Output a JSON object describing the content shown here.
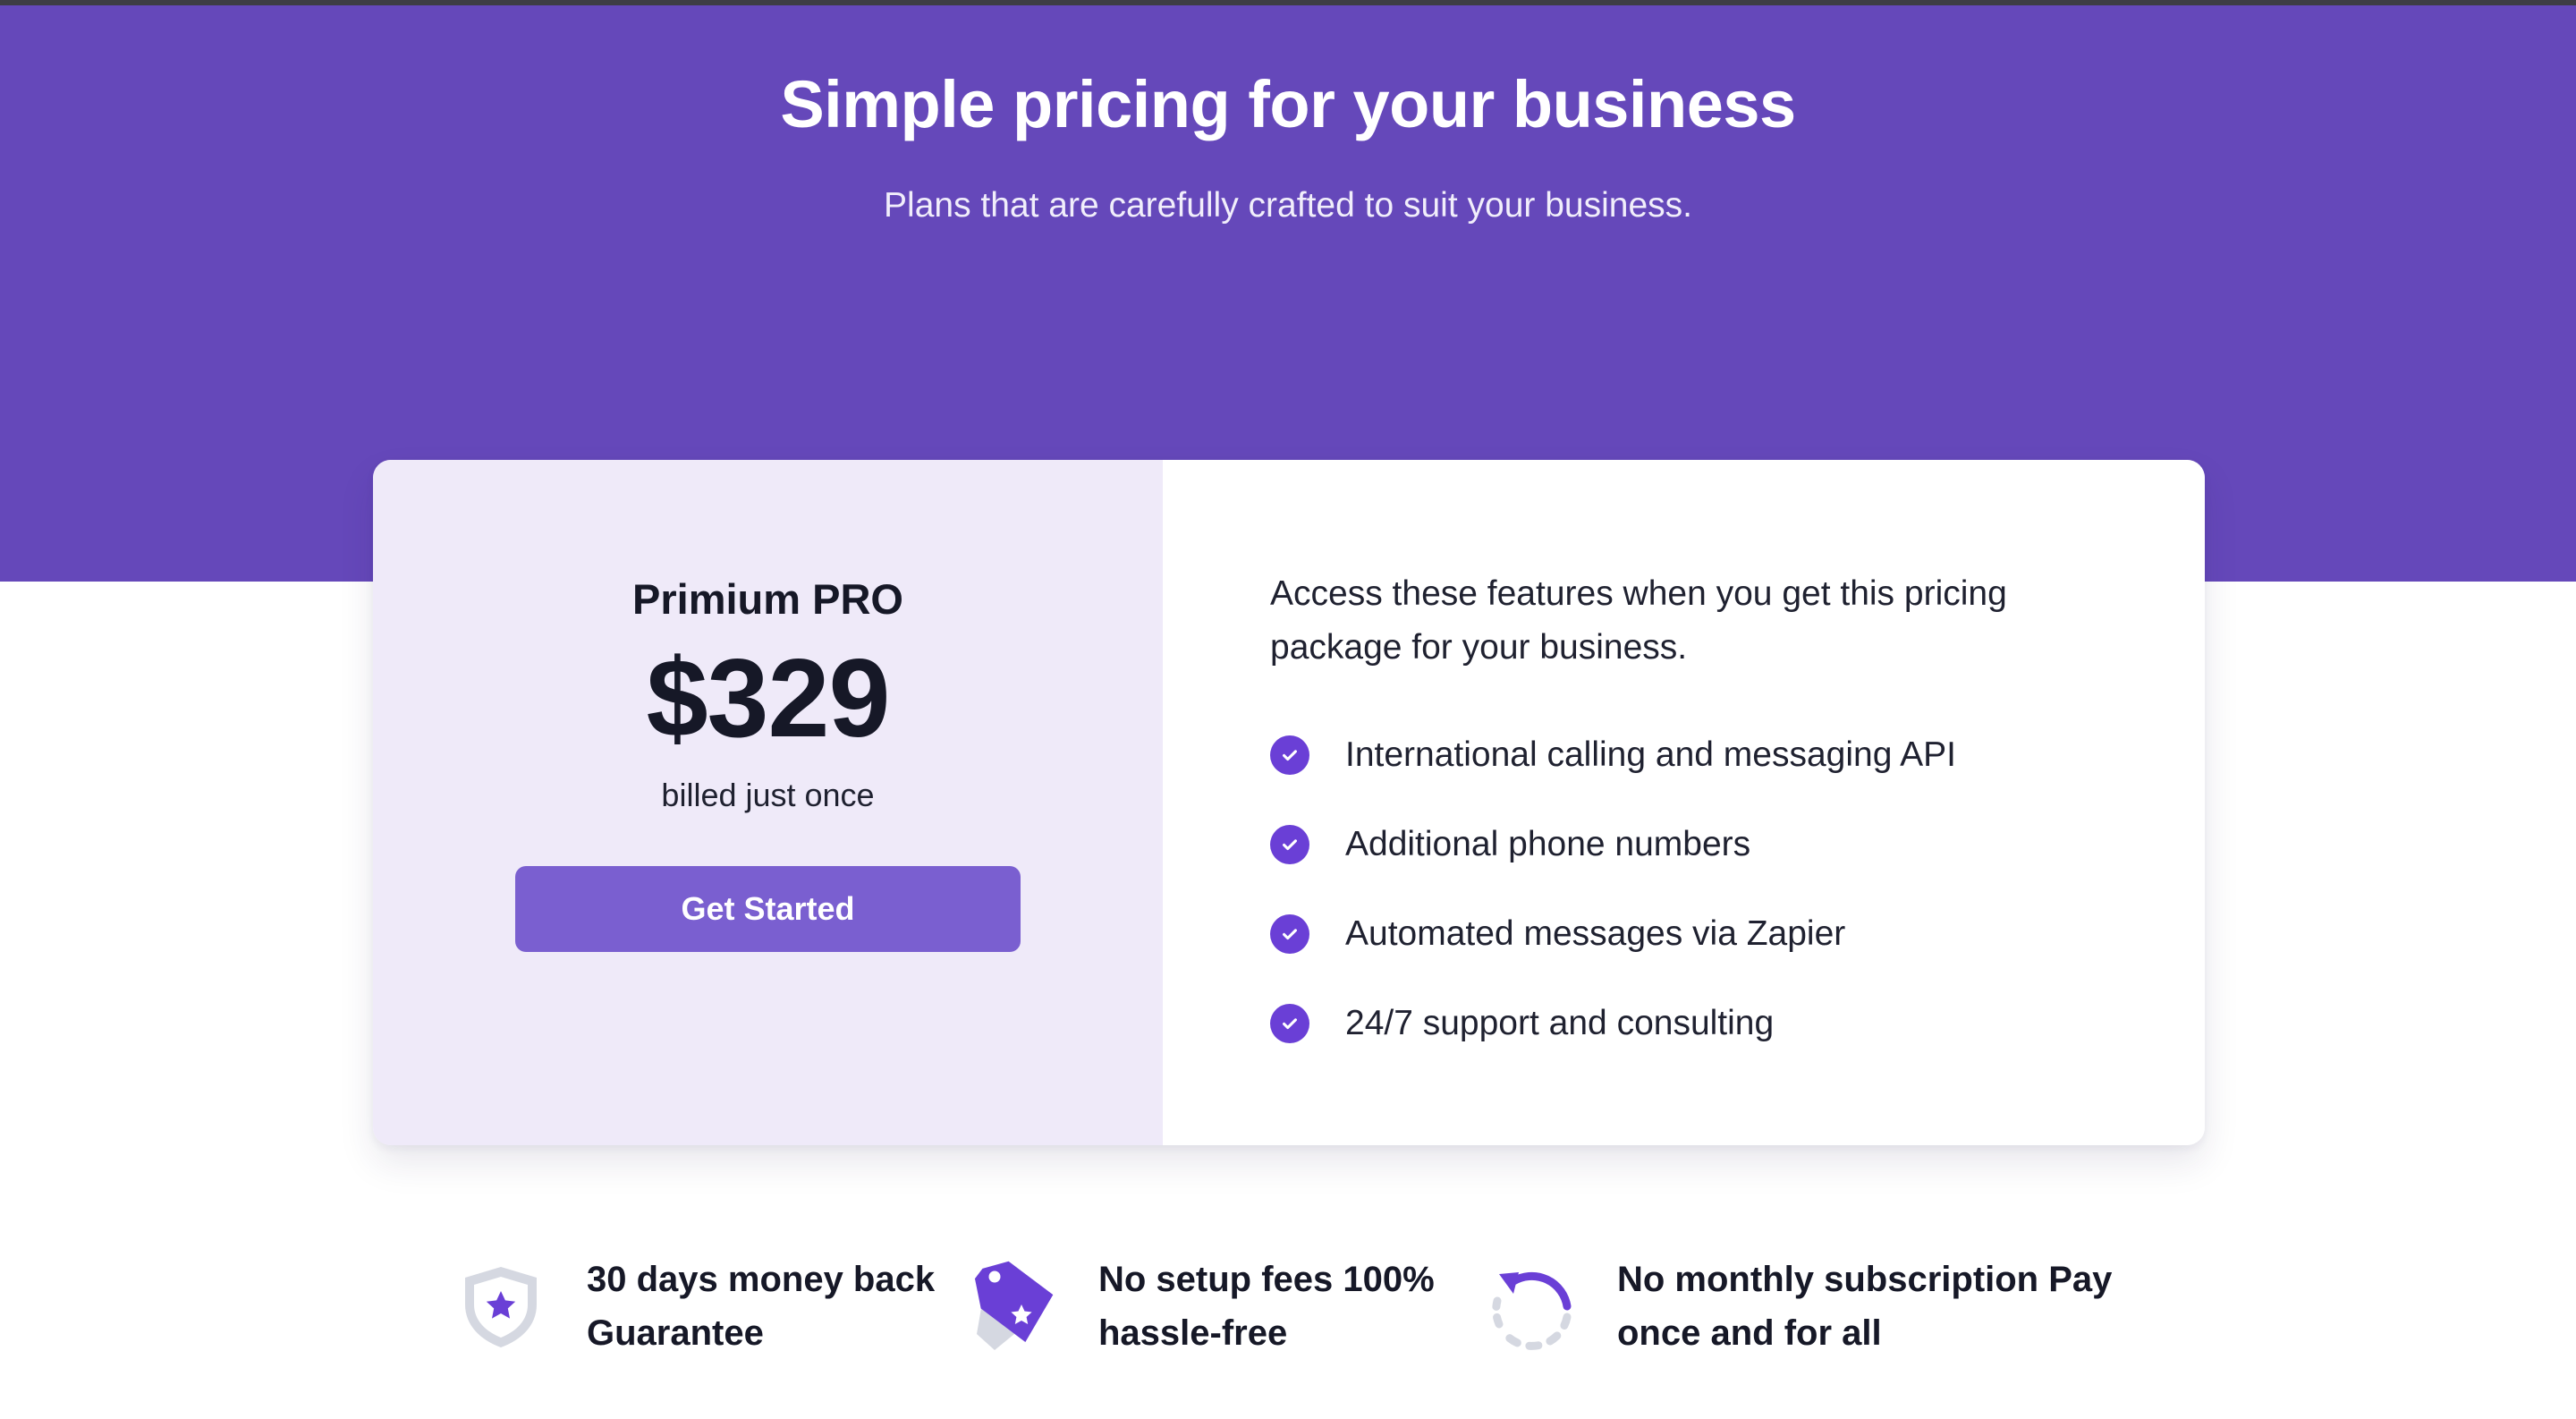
{
  "colors": {
    "hero_bg": "#6548ba",
    "card_left_bg": "#efeaf9",
    "button_bg": "#7a5fd0",
    "check_bg": "#6a3fd6",
    "text_dark": "#161827"
  },
  "hero": {
    "title": "Simple pricing for your business",
    "subtitle": "Plans that are carefully crafted to suit your business."
  },
  "plan": {
    "name": "Primium PRO",
    "price": "$329",
    "billing": "billed just once",
    "cta_label": "Get Started"
  },
  "features": {
    "intro": "Access these features when you get this pricing package for your business.",
    "items": [
      {
        "label": "International calling and messaging API",
        "icon": "check-circle-icon"
      },
      {
        "label": "Additional phone numbers",
        "icon": "check-circle-icon"
      },
      {
        "label": "Automated messages via Zapier",
        "icon": "check-circle-icon"
      },
      {
        "label": "24/7 support and consulting",
        "icon": "check-circle-icon"
      }
    ]
  },
  "perks": [
    {
      "line1": "30 days money back",
      "line2": "Guarantee",
      "icon": "shield-star-icon"
    },
    {
      "line1": "No setup fees 100%",
      "line2": "hassle-free",
      "icon": "price-tag-icon"
    },
    {
      "line1": "No monthly subscription Pay",
      "line2": "once and for all",
      "icon": "refresh-icon"
    }
  ]
}
